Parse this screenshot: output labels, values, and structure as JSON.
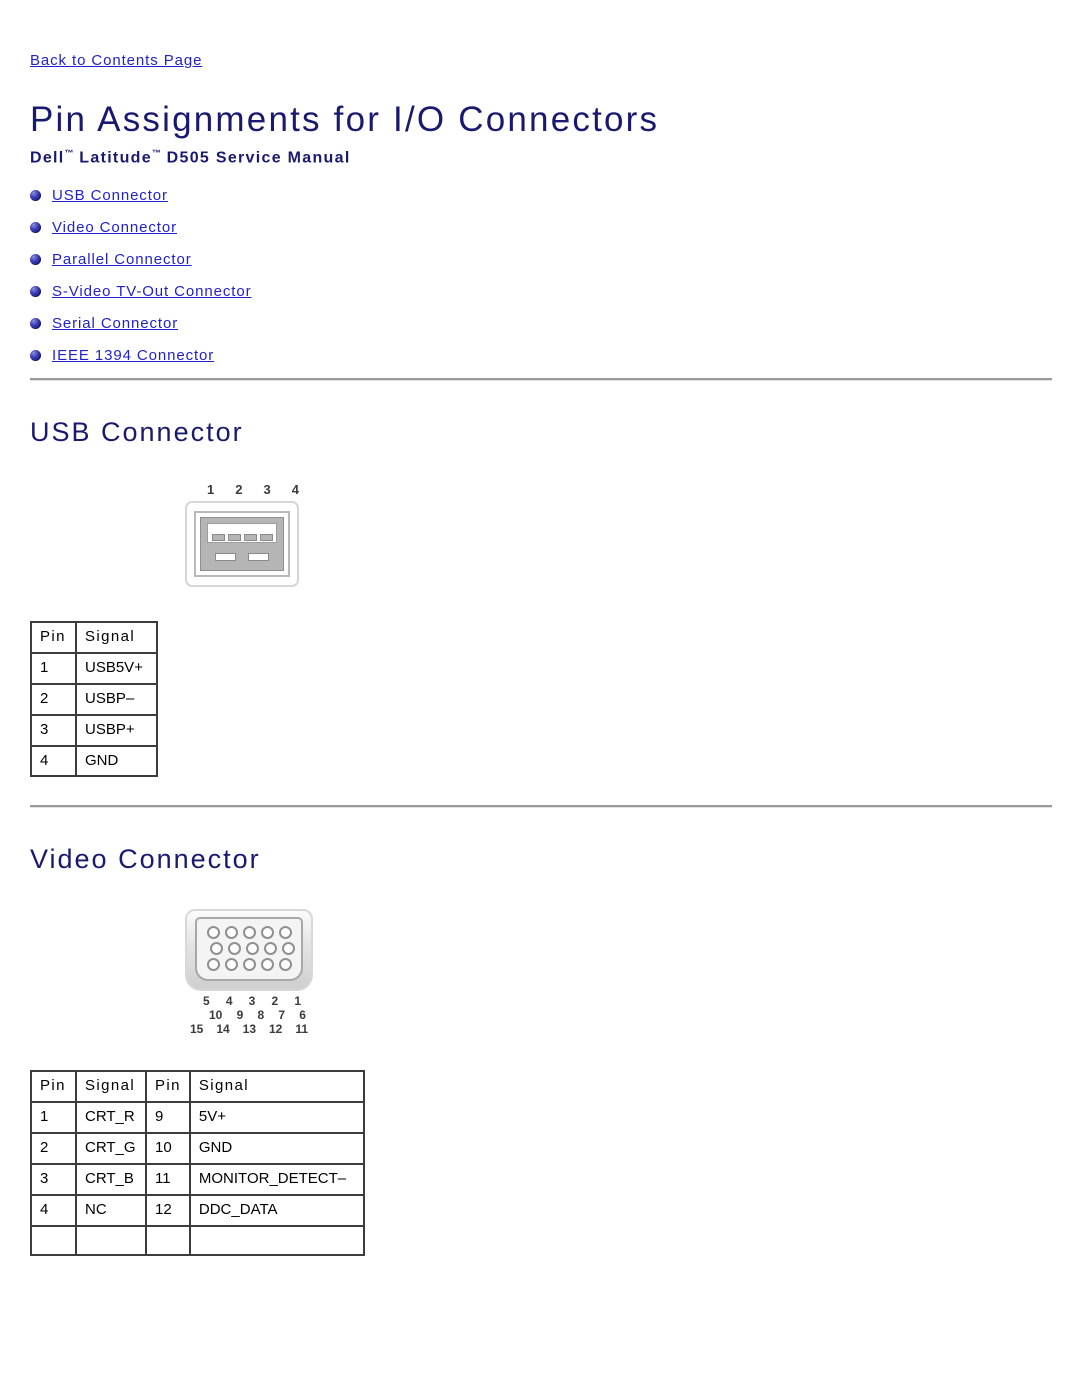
{
  "back_link": {
    "label": "Back to Contents Page"
  },
  "header": {
    "title": "Pin Assignments for I/O Connectors",
    "subtitle_pre": "Dell",
    "subtitle_tm1": "™",
    "subtitle_mid": " Latitude",
    "subtitle_tm2": "™",
    "subtitle_post": " D505 Service Manual"
  },
  "toc": {
    "items": [
      {
        "label": "USB Connector"
      },
      {
        "label": "Video Connector"
      },
      {
        "label": "Parallel Connector"
      },
      {
        "label": "S-Video TV-Out Connector"
      },
      {
        "label": "Serial Connector"
      },
      {
        "label": "IEEE 1394 Connector"
      }
    ]
  },
  "sections": [
    {
      "heading": "USB Connector",
      "figure": {
        "type": "usb-a-port",
        "pin_numbers": [
          "1",
          "2",
          "3",
          "4"
        ]
      },
      "table": {
        "headers": [
          "Pin",
          "Signal"
        ],
        "rows": [
          [
            "1",
            "USB5V+"
          ],
          [
            "2",
            "USBP–"
          ],
          [
            "3",
            "USBP+"
          ],
          [
            "4",
            "GND"
          ]
        ]
      }
    },
    {
      "heading": "Video Connector",
      "figure": {
        "type": "vga-15-pin",
        "label_row_1": [
          "5",
          "4",
          "3",
          "2",
          "1"
        ],
        "label_row_2": [
          "10",
          "9",
          "8",
          "7",
          "6"
        ],
        "label_row_3": [
          "15",
          "14",
          "13",
          "12",
          "11"
        ]
      },
      "table": {
        "headers": [
          "Pin",
          "Signal",
          "Pin",
          "Signal"
        ],
        "rows": [
          [
            "1",
            "CRT_R",
            "9",
            "5V+"
          ],
          [
            "2",
            "CRT_G",
            "10",
            "GND"
          ],
          [
            "3",
            "CRT_B",
            "11",
            "MONITOR_DETECT–"
          ],
          [
            "4",
            "NC",
            "12",
            "DDC_DATA"
          ],
          [
            "",
            "",
            "",
            ""
          ]
        ]
      }
    }
  ],
  "colors": {
    "heading": "#191970",
    "link": "#2222cc",
    "rule": "#9a9a9a",
    "table_border": "#3c3c3c"
  }
}
